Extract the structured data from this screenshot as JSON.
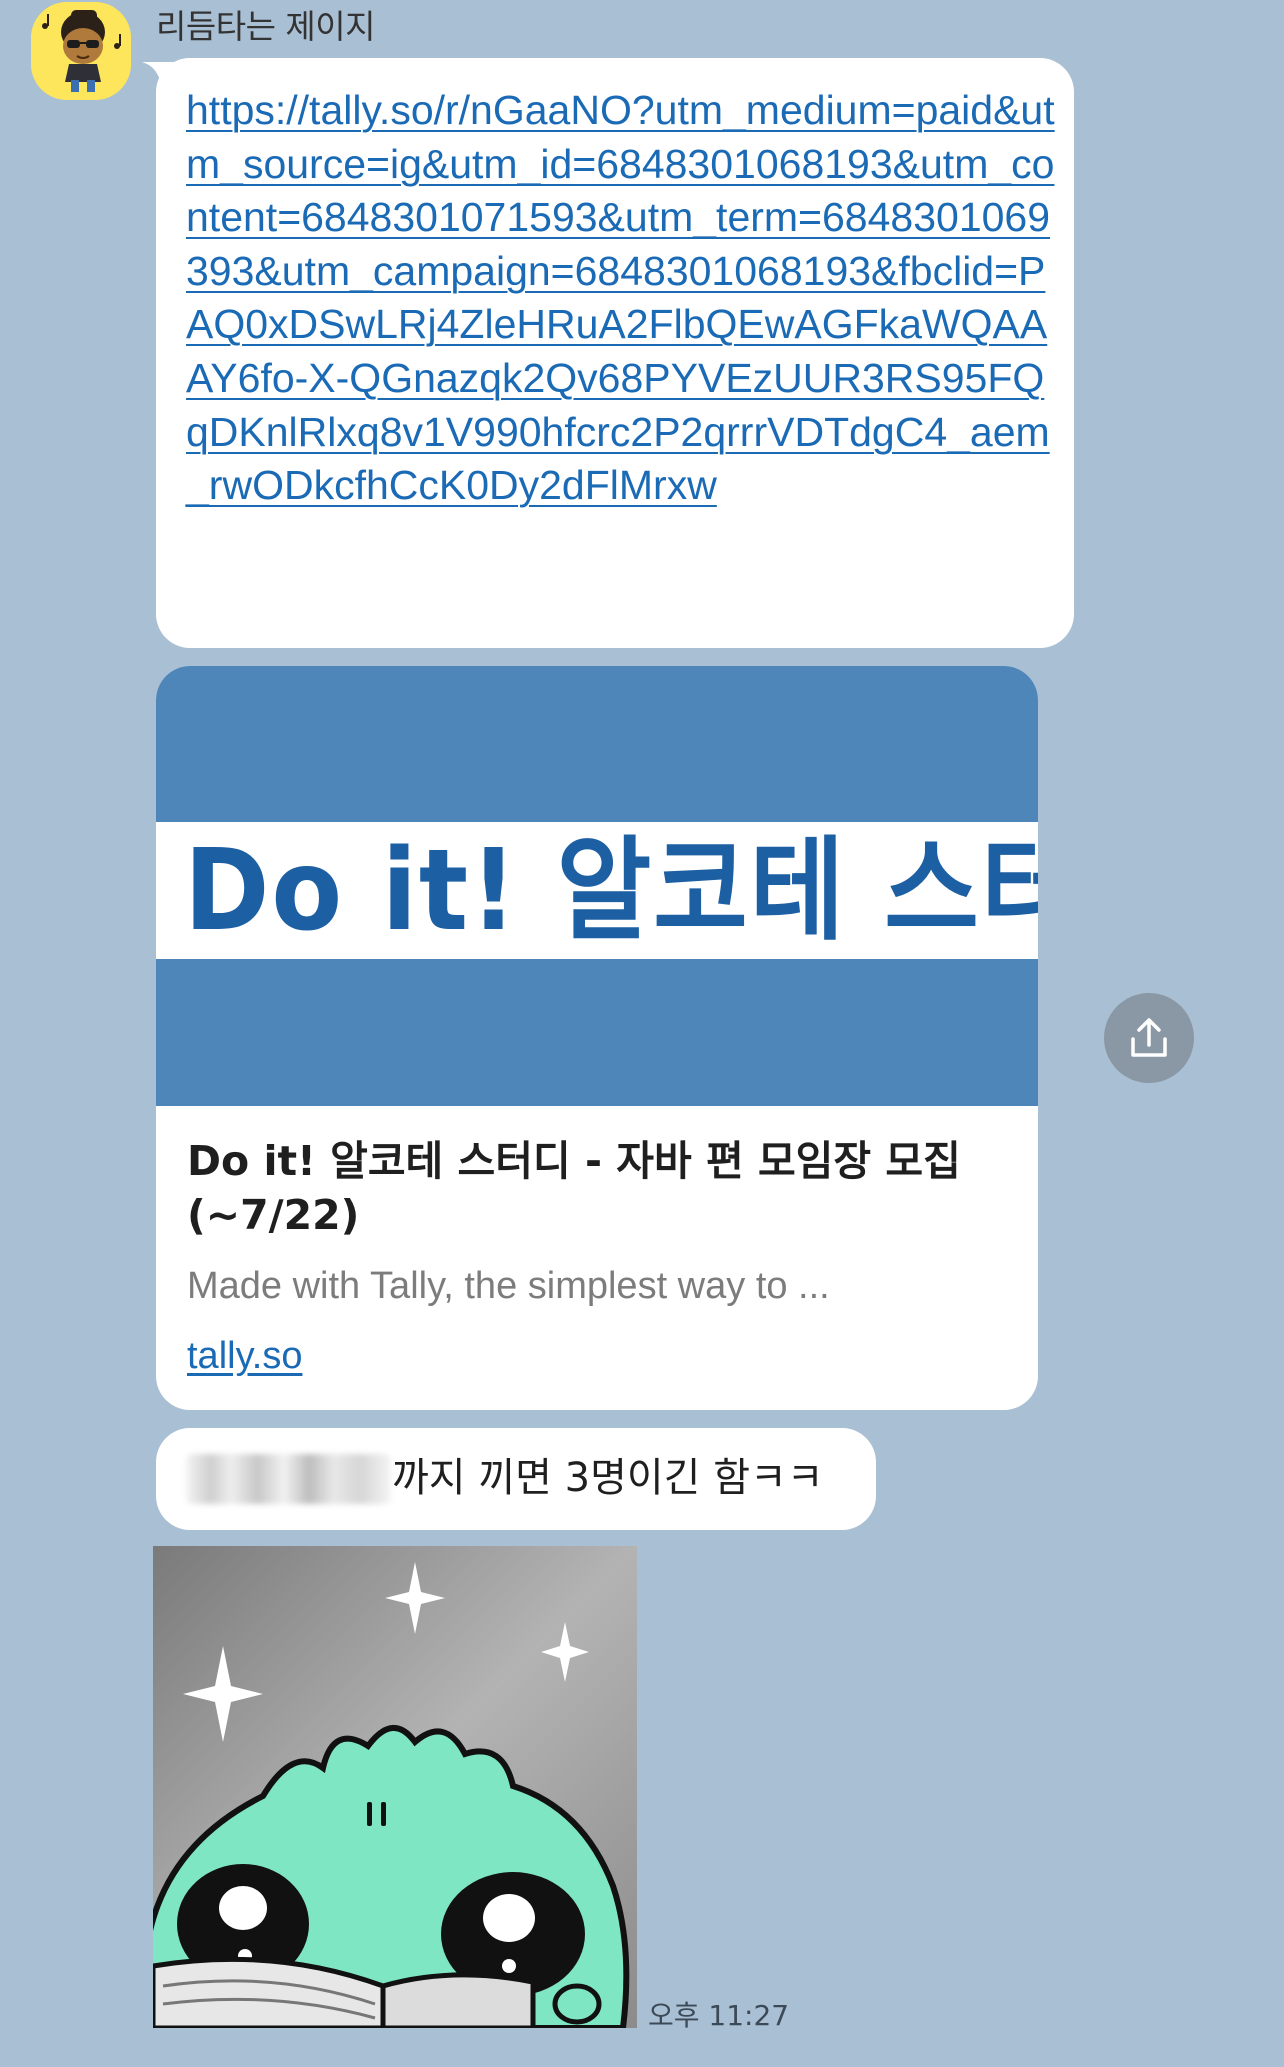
{
  "chat": {
    "sender_name": "리듬타는 제이지",
    "timestamp": "오후 11:27"
  },
  "link_message": {
    "url": "https://tally.so/r/nGaaNO?utm_medium=paid&utm_source=ig&utm_id=6848301068193&utm_content=6848301071593&utm_term=6848301069393&utm_campaign=6848301068193&fbclid=PAQ0xDSwLRj4ZleHRuA2FlbQEwAGFkaWQAAAY6fo-X-QGnazqk2Qv68PYVEzUUR3RS95FQqDKnlRlxq8v1V990hfcrc2P2qrrrVDTdgC4_aem_rwODkcfhCcK0Dy2dFlMrxw"
  },
  "link_preview": {
    "banner_text": "Do it! 알코테 스터디",
    "title": "Do it! 알코테 스터디 - 자바 편 모임장 모집 (~7/22)",
    "description": "Made with Tally, the simplest way to ...",
    "domain": "tally.so"
  },
  "text_message": {
    "text": "까지 끼면 3명이긴 함ㅋㅋ"
  },
  "icons": {
    "share": "share-upload-icon",
    "avatar": "profile-avatar-icon",
    "sticker": "reading-green-character-sticker"
  },
  "colors": {
    "chat_background": "#a9bfd4",
    "link": "#1a6ab5",
    "banner_blue": "#4f86b9",
    "banner_text": "#1d5fa3",
    "avatar_yellow": "#fde55c",
    "sticker_green": "#7fe6c4"
  }
}
